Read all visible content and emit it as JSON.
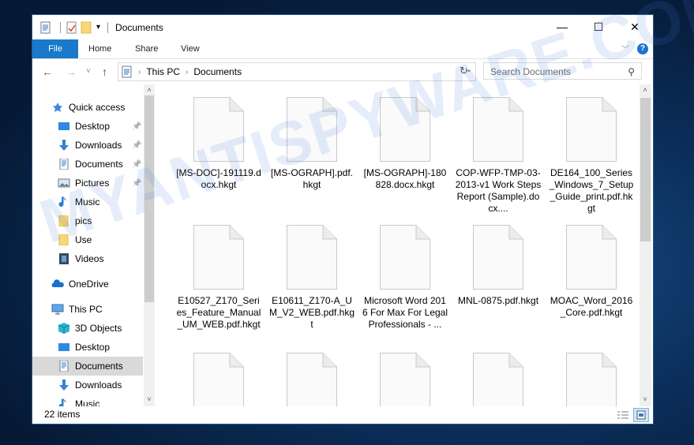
{
  "window": {
    "title": "Documents",
    "controls": {
      "minimize": "—",
      "maximize": "☐",
      "close": "✕"
    }
  },
  "ribbon": {
    "tabs": [
      "File",
      "Home",
      "Share",
      "View"
    ],
    "expand_icon": "chevron-down-icon",
    "help_label": "?"
  },
  "navigation": {
    "back": "←",
    "forward": "→",
    "recent": "˅",
    "up": "↑",
    "breadcrumb": [
      "This PC",
      "Documents"
    ],
    "search_placeholder": "Search Documents"
  },
  "sidebar": {
    "items": [
      {
        "label": "Quick access",
        "icon": "star-icon",
        "pinned": false,
        "selected": false
      },
      {
        "label": "Desktop",
        "icon": "desktop-icon",
        "pinned": true,
        "selected": false
      },
      {
        "label": "Downloads",
        "icon": "download-icon",
        "pinned": true,
        "selected": false
      },
      {
        "label": "Documents",
        "icon": "documents-icon",
        "pinned": true,
        "selected": false
      },
      {
        "label": "Pictures",
        "icon": "pictures-icon",
        "pinned": true,
        "selected": false
      },
      {
        "label": "Music",
        "icon": "music-icon",
        "pinned": false,
        "selected": false
      },
      {
        "label": "pics",
        "icon": "folder-icon",
        "pinned": false,
        "selected": false
      },
      {
        "label": "Use",
        "icon": "folder-icon",
        "pinned": false,
        "selected": false
      },
      {
        "label": "Videos",
        "icon": "videos-icon",
        "pinned": false,
        "selected": false
      },
      {
        "label": "OneDrive",
        "icon": "onedrive-icon",
        "pinned": false,
        "selected": false
      },
      {
        "label": "This PC",
        "icon": "this-pc-icon",
        "pinned": false,
        "selected": false
      },
      {
        "label": "3D Objects",
        "icon": "3d-objects-icon",
        "pinned": false,
        "selected": false
      },
      {
        "label": "Desktop",
        "icon": "desktop-icon",
        "pinned": false,
        "selected": false
      },
      {
        "label": "Documents",
        "icon": "documents-icon",
        "pinned": false,
        "selected": true
      },
      {
        "label": "Downloads",
        "icon": "download-icon",
        "pinned": false,
        "selected": false
      },
      {
        "label": "Music",
        "icon": "music-icon",
        "pinned": false,
        "selected": false
      }
    ]
  },
  "files": [
    {
      "name": "[MS-DOC]-191119.docx.hkgt"
    },
    {
      "name": "[MS-OGRAPH].pdf.hkgt"
    },
    {
      "name": "[MS-OGRAPH]-180828.docx.hkgt"
    },
    {
      "name": "COP-WFP-TMP-03-2013-v1 Work Steps Report (Sample).docx...."
    },
    {
      "name": "DE164_100_Series_Windows_7_Setup_Guide_print.pdf.hkgt"
    },
    {
      "name": "E10527_Z170_Series_Feature_Manual_UM_WEB.pdf.hkgt"
    },
    {
      "name": "E10611_Z170-A_UM_V2_WEB.pdf.hkgt"
    },
    {
      "name": "Microsoft Word 2016 For Max For Legal Professionals - ..."
    },
    {
      "name": "MNL-0875.pdf.hkgt"
    },
    {
      "name": "MOAC_Word_2016_Core.pdf.hkgt"
    },
    {
      "name": ""
    },
    {
      "name": ""
    },
    {
      "name": ""
    },
    {
      "name": ""
    },
    {
      "name": ""
    }
  ],
  "status": {
    "item_count": "22 items"
  },
  "watermark": "MYANTISPYWARE.COM",
  "colors": {
    "accent": "#1979ca",
    "selected": "#d9d9d9",
    "help": "#1a73d1"
  }
}
